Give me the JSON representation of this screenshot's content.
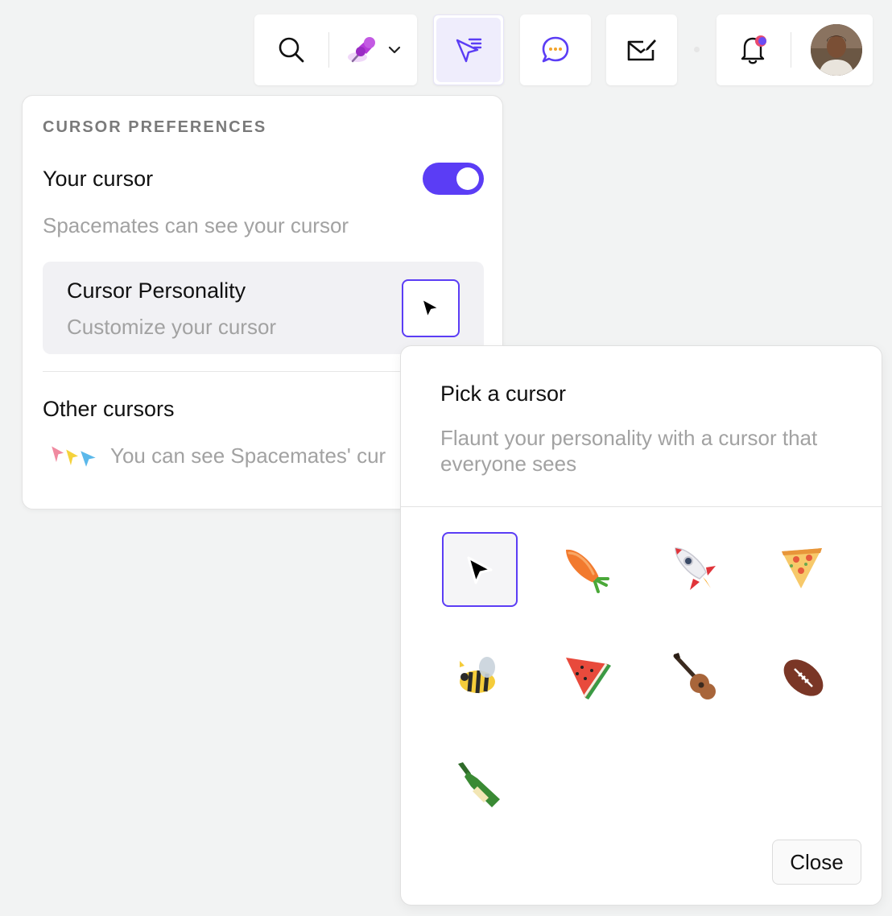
{
  "toolbar": {
    "search_icon": "search-icon",
    "pin_icon": "pushpin-icon",
    "cursor_icon": "cursor-settings-icon",
    "chat_icon": "chat-bubble-icon",
    "compose_icon": "compose-icon",
    "bell_icon": "bell-icon",
    "accent_color": "#5b3df5",
    "active_bg": "#efedfc"
  },
  "prefs": {
    "heading": "CURSOR PREFERENCES",
    "your_cursor_label": "Your cursor",
    "toggle_on": true,
    "your_cursor_desc": "Spacemates can see your cursor",
    "personality_title": "Cursor Personality",
    "personality_desc": "Customize your cursor",
    "other_cursors_label": "Other cursors",
    "other_cursors_desc": "You can see Spacemates' cur"
  },
  "picker": {
    "title": "Pick a cursor",
    "description": "Flaunt your personality with a cursor that everyone sees",
    "options": [
      {
        "name": "arrow",
        "selected": true
      },
      {
        "name": "carrot",
        "selected": false
      },
      {
        "name": "rocket",
        "selected": false
      },
      {
        "name": "pizza",
        "selected": false
      },
      {
        "name": "bee",
        "selected": false
      },
      {
        "name": "watermelon",
        "selected": false
      },
      {
        "name": "guitar",
        "selected": false
      },
      {
        "name": "football",
        "selected": false
      },
      {
        "name": "bottle",
        "selected": false
      }
    ],
    "close_label": "Close"
  }
}
